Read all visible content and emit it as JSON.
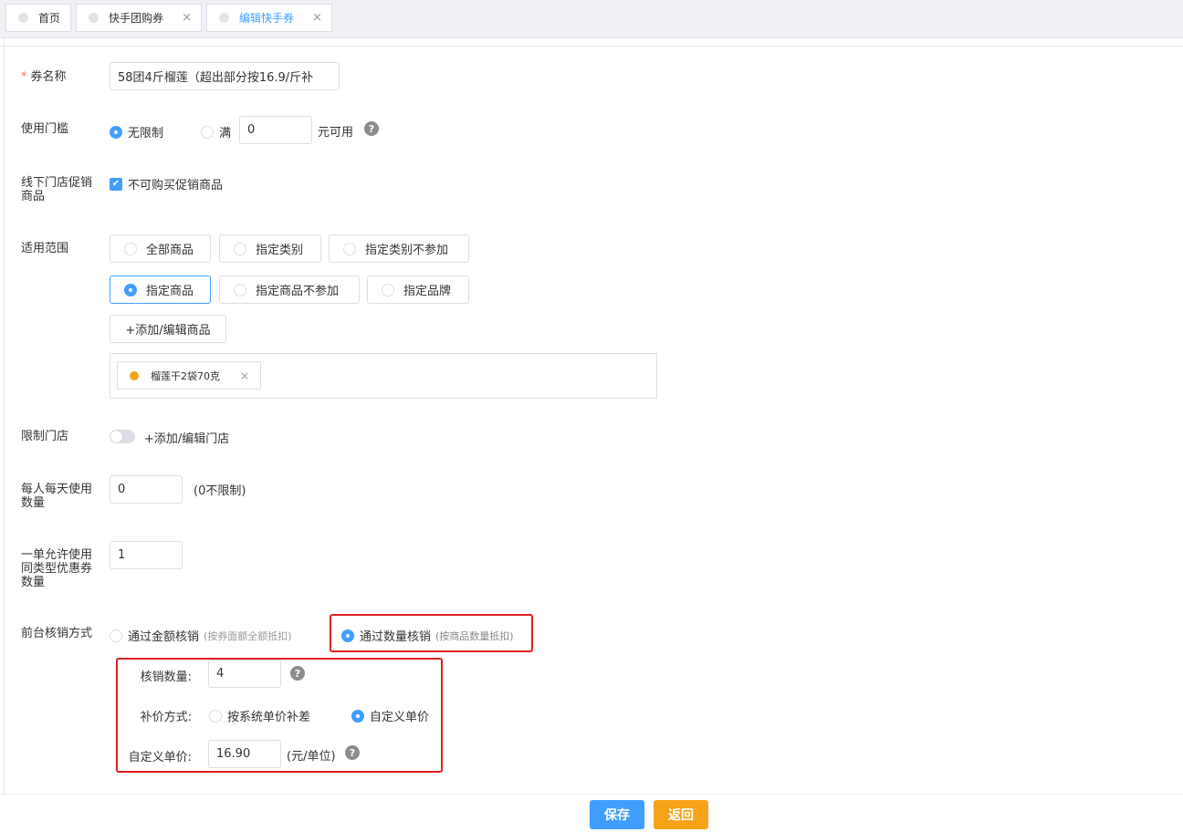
{
  "tabs": [
    {
      "label": "首页"
    },
    {
      "label": "快手团购券",
      "close": "×"
    },
    {
      "label": "编辑快手券",
      "close": "×"
    }
  ],
  "coupon_name": {
    "label": "券名称",
    "required_mark": "*",
    "value": "58团4斤榴莲（超出部分按16.9/斤补"
  },
  "threshold": {
    "label": "使用门槛",
    "option_unlimited": "无限制",
    "option_full": "满",
    "amount_value": "0",
    "suffix": "元可用",
    "help": "?"
  },
  "offline_promo": {
    "label": "线下门店促销商品",
    "checkbox_label": "不可购买促销商品",
    "checked": true
  },
  "scope": {
    "label": "适用范围",
    "options_row1": [
      "全部商品",
      "指定类别",
      "指定类别不参加"
    ],
    "options_row2": [
      "指定商品",
      "指定商品不参加",
      "指定品牌"
    ],
    "selected": "指定商品",
    "add_goods_button": "+添加/编辑商品",
    "goods": [
      {
        "name": "榴莲干2袋70克",
        "remove": "×"
      }
    ]
  },
  "store_limit": {
    "label": "限制门店",
    "enabled": false,
    "add_store_link": "+添加/编辑门店"
  },
  "daily_limit": {
    "label": "每人每天使用数量",
    "value": "0",
    "hint": "(0不限制)"
  },
  "same_type_limit": {
    "label": "一单允许使用同类型优惠券数量",
    "value": "1"
  },
  "redeem": {
    "label": "前台核销方式",
    "option_amount": "通过金额核销",
    "option_amount_hint": "(按券面额全额抵扣)",
    "option_quantity": "通过数量核销",
    "option_quantity_hint": "(按商品数量抵扣)",
    "selected": "通过数量核销",
    "qty_label": "核销数量:",
    "qty_value": "4",
    "qty_help": "?",
    "supp_label": "补价方式:",
    "supp_option_system": "按系统单价补差",
    "supp_option_custom": "自定义单价",
    "supp_selected": "自定义单价",
    "unit_price_label": "自定义单价:",
    "unit_price_value": "16.90",
    "unit_price_suffix": "(元/单位)",
    "unit_help": "?"
  },
  "footer": {
    "save": "保存",
    "back": "返回"
  },
  "colors": {
    "primary": "#409eff",
    "warning": "#f7a317",
    "highlight": "#e02020"
  }
}
